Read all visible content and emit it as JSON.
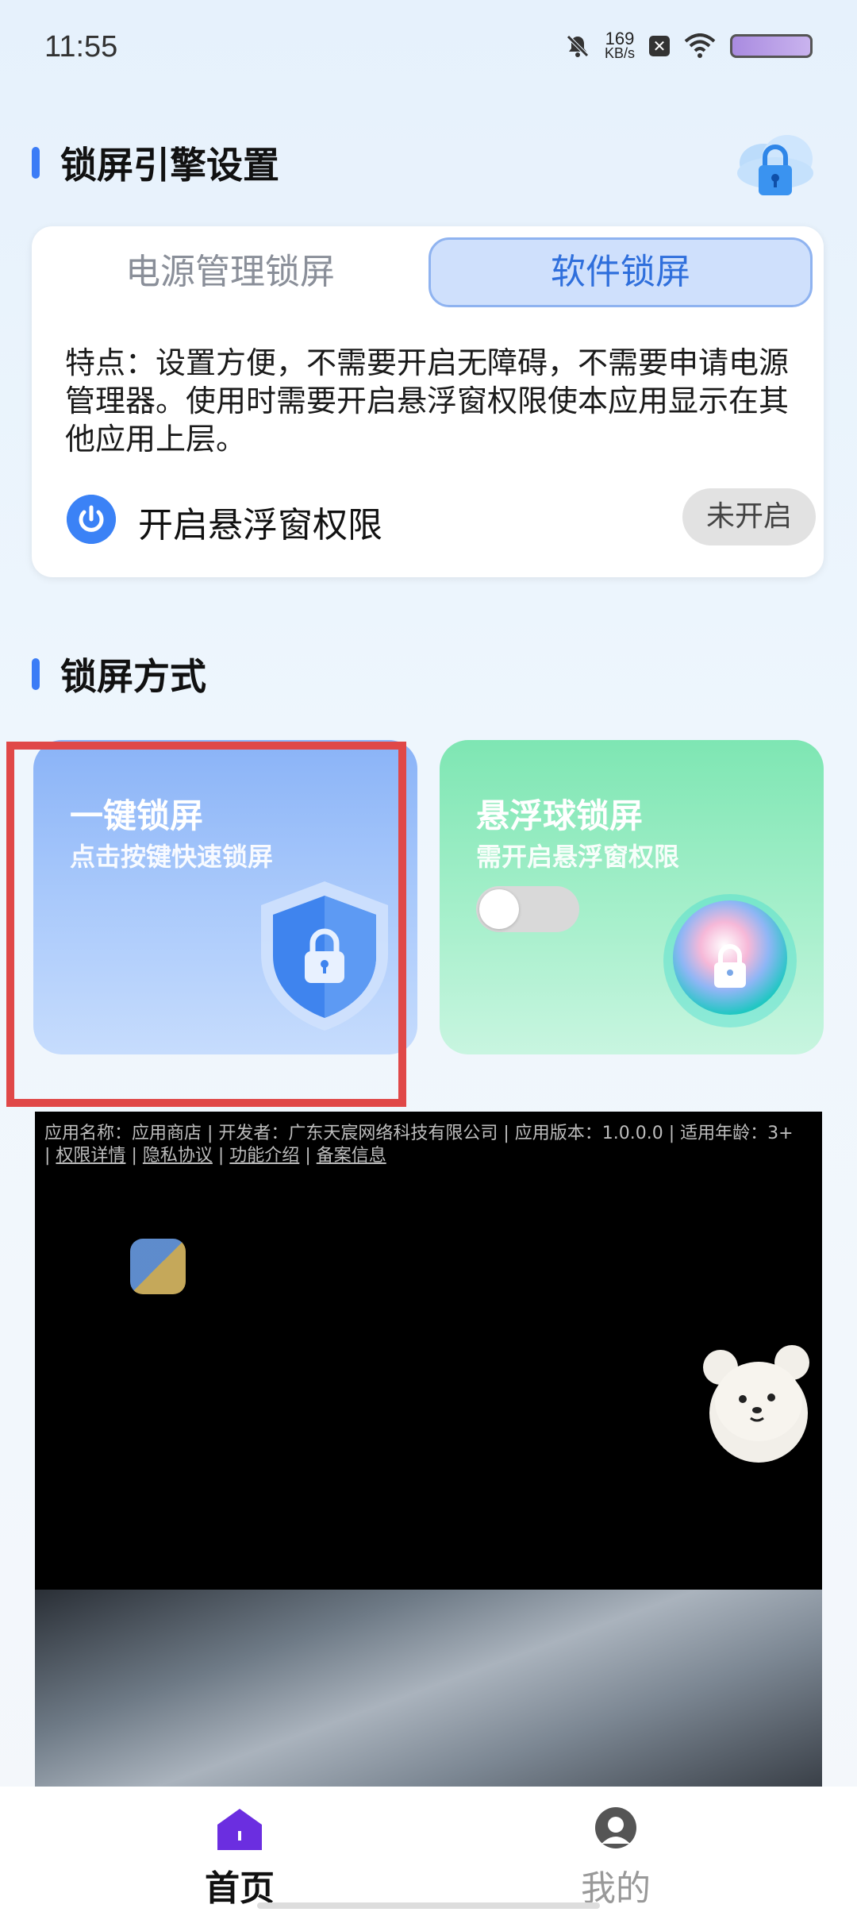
{
  "status_bar": {
    "time": "11:55",
    "speed_value": "169",
    "speed_unit": "KB/s"
  },
  "engine_section": {
    "title": "锁屏引擎设置",
    "tabs": [
      {
        "label": "电源管理锁屏",
        "selected": false
      },
      {
        "label": "软件锁屏",
        "selected": true
      }
    ],
    "feature_text": "特点：设置方便，不需要开启无障碍，不需要申请电源管理器。使用时需要开启悬浮窗权限使本应用显示在其他应用上层。",
    "permission": {
      "label": "开启悬浮窗权限",
      "status": "未开启"
    }
  },
  "lock_mode_section": {
    "title": "锁屏方式",
    "cards": [
      {
        "title": "一键锁屏",
        "subtitle": "点击按键快速锁屏"
      },
      {
        "title": "悬浮球锁屏",
        "subtitle": "需开启悬浮窗权限",
        "toggle_on": false
      }
    ]
  },
  "ad": {
    "info_line": "应用名称：应用商店 | 开发者：广东天宸网络科技有限公司 | 应用版本：1.0.0.0 | 适用年龄：3+",
    "links": [
      "权限详情",
      "隐私协议",
      "功能介绍",
      "备案信息"
    ],
    "separator": "|"
  },
  "bottom_nav": {
    "items": [
      {
        "label": "首页",
        "active": true
      },
      {
        "label": "我的",
        "active": false
      }
    ]
  },
  "colors": {
    "accent": "#3b7cf6",
    "tab_selected_bg": "#cfe0fc",
    "card_blue": "#8ab3f7",
    "card_green": "#7ee6b3",
    "highlight": "#e04848",
    "nav_home_icon": "#6b2ee0"
  }
}
